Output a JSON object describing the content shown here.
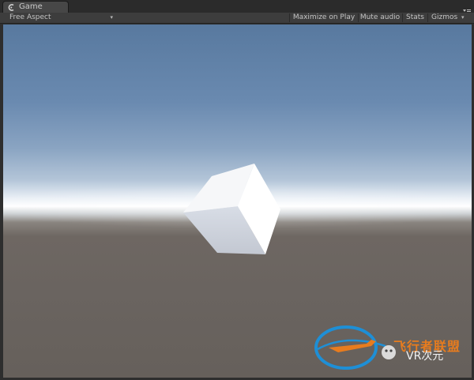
{
  "window": {
    "tab_label": "Game",
    "tab_icon": "unity-game-icon",
    "panel_menu_icon": "panel-menu-icon"
  },
  "toolbar": {
    "aspect_label": "Free Aspect",
    "aspect_chevron": "▾",
    "maximize_on_play_label": "Maximize on Play",
    "mute_audio_label": "Mute audio",
    "stats_label": "Stats",
    "gizmos_label": "Gizmos",
    "gizmos_chevron": "▾"
  },
  "viewport": {
    "sky_top_color": "#58799f",
    "horizon_color": "#ffffff",
    "ground_color": "#6a6460",
    "object": "white-cube"
  },
  "watermark": {
    "brand_text": "飞行者联盟",
    "brand_color": "#e87c1e",
    "channel_text": "VR次元"
  }
}
